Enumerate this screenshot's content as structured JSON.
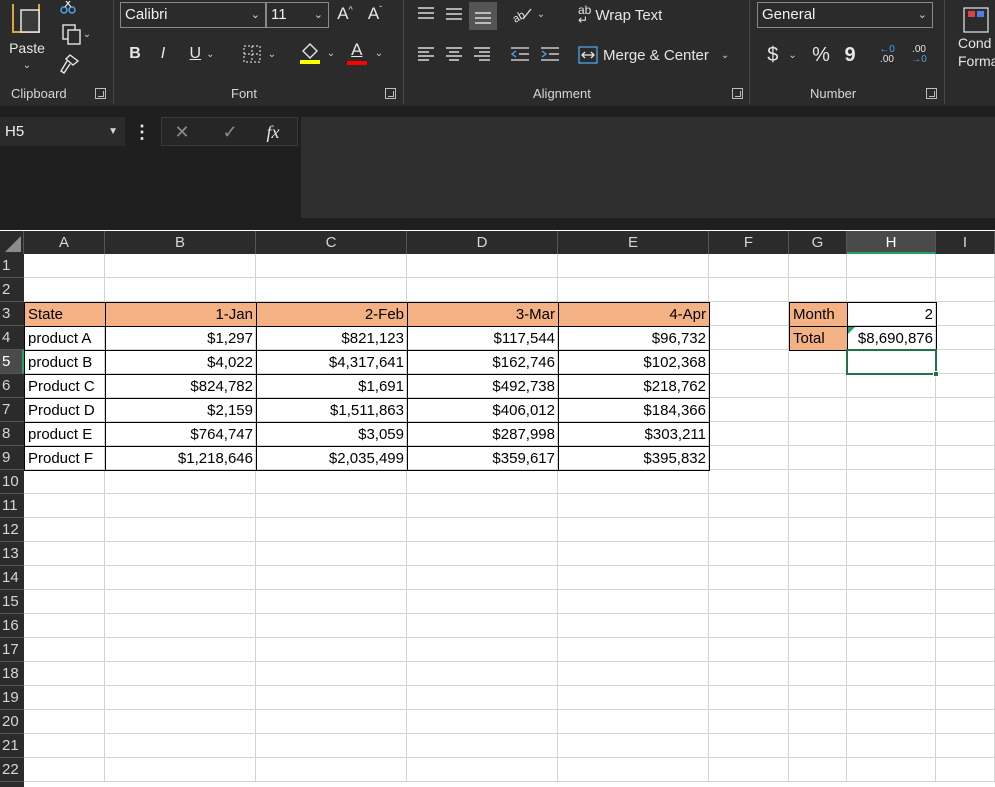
{
  "ribbon": {
    "clipboard": {
      "label": "Clipboard",
      "paste_label": "Paste"
    },
    "font": {
      "label": "Font",
      "font_name": "Calibri",
      "font_size": "11",
      "bold": "B",
      "italic": "I",
      "underline": "U",
      "grow_label": "A^",
      "shrink_label": "Aˇ",
      "font_color_label": "A"
    },
    "alignment": {
      "label": "Alignment",
      "wrap_text": "Wrap Text",
      "merge_center": "Merge & Center"
    },
    "number": {
      "label": "Number",
      "format": "General",
      "currency": "$",
      "percent": "%",
      "comma": "9",
      "inc_decimal": ".00",
      "dec_decimal": ".00"
    },
    "styles": {
      "cond_format_line1": "Cond",
      "cond_format_line2": "Forma"
    }
  },
  "formula_bar": {
    "name_box": "H5",
    "formula": ""
  },
  "columns": [
    "A",
    "B",
    "C",
    "D",
    "E",
    "F",
    "G",
    "H",
    "I"
  ],
  "rows": [
    "1",
    "2",
    "3",
    "4",
    "5",
    "6",
    "7",
    "8",
    "9",
    "10",
    "11",
    "12",
    "13",
    "14",
    "15",
    "16",
    "17",
    "18",
    "19",
    "20",
    "21",
    "22"
  ],
  "table": {
    "header": [
      "State",
      "1-Jan",
      "2-Feb",
      "3-Mar",
      "4-Apr"
    ],
    "rows": [
      [
        "product A",
        "$1,297",
        "$821,123",
        "$117,544",
        "$96,732"
      ],
      [
        "product B",
        "$4,022",
        "$4,317,641",
        "$162,746",
        "$102,368"
      ],
      [
        "Product C",
        "$824,782",
        "$1,691",
        "$492,738",
        "$218,762"
      ],
      [
        "Product D",
        "$2,159",
        "$1,511,863",
        "$406,012",
        "$184,366"
      ],
      [
        "product E",
        "$764,747",
        "$3,059",
        "$287,998",
        "$303,211"
      ],
      [
        "Product F",
        "$1,218,646",
        "$2,035,499",
        "$359,617",
        "$395,832"
      ]
    ]
  },
  "summary": {
    "month_label": "Month",
    "month_value": "2",
    "total_label": "Total",
    "total_value": "$8,690,876"
  },
  "selected": {
    "column": "H",
    "row": "5"
  },
  "colors": {
    "header_fill": "#f4b183",
    "selection": "#217346",
    "ribbon_bg": "#2b2b2b"
  }
}
